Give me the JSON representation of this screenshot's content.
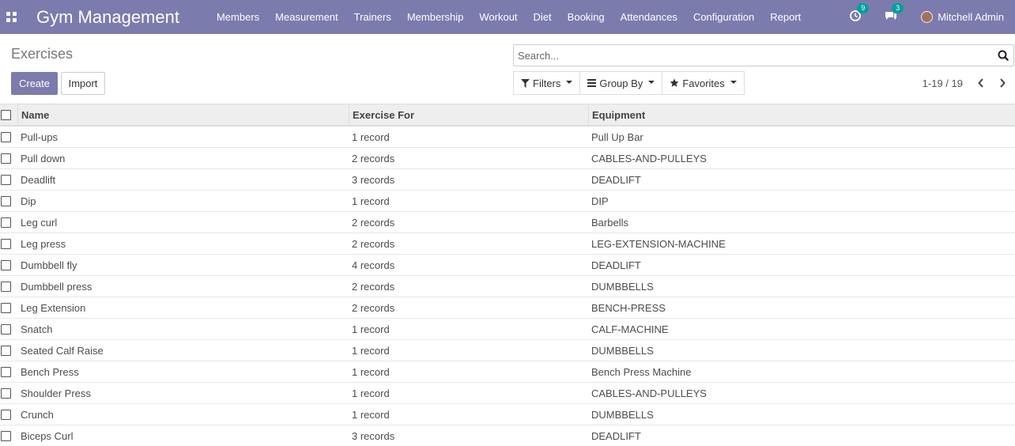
{
  "navbar": {
    "app_title": "Gym Management",
    "menu": [
      "Members",
      "Measurement",
      "Trainers",
      "Membership",
      "Workout",
      "Diet",
      "Booking",
      "Attendances",
      "Configuration",
      "Report"
    ],
    "activity_count": "9",
    "messages_count": "3",
    "user_name": "Mitchell Admin"
  },
  "control_panel": {
    "title": "Exercises",
    "create_label": "Create",
    "import_label": "Import",
    "search_placeholder": "Search...",
    "filters_label": "Filters",
    "group_by_label": "Group By",
    "favorites_label": "Favorites",
    "pager_value": "1-19 / 19"
  },
  "table": {
    "headers": {
      "name": "Name",
      "exercise_for": "Exercise For",
      "equipment": "Equipment"
    },
    "rows": [
      {
        "name": "Pull-ups",
        "exercise_for": "1 record",
        "equipment": "Pull Up Bar"
      },
      {
        "name": "Pull down",
        "exercise_for": "2 records",
        "equipment": "CABLES-AND-PULLEYS"
      },
      {
        "name": "Deadlift",
        "exercise_for": "3 records",
        "equipment": "DEADLIFT"
      },
      {
        "name": "Dip",
        "exercise_for": "1 record",
        "equipment": "DIP"
      },
      {
        "name": "Leg curl",
        "exercise_for": "2 records",
        "equipment": "Barbells"
      },
      {
        "name": "Leg press",
        "exercise_for": "2 records",
        "equipment": "LEG-EXTENSION-MACHINE"
      },
      {
        "name": "Dumbbell fly",
        "exercise_for": "4 records",
        "equipment": "DEADLIFT"
      },
      {
        "name": "Dumbbell press",
        "exercise_for": "2 records",
        "equipment": "DUMBBELLS"
      },
      {
        "name": "Leg Extension",
        "exercise_for": "2 records",
        "equipment": "BENCH-PRESS"
      },
      {
        "name": "Snatch",
        "exercise_for": "1 record",
        "equipment": "CALF-MACHINE"
      },
      {
        "name": "Seated Calf Raise",
        "exercise_for": "1 record",
        "equipment": "DUMBBELLS"
      },
      {
        "name": "Bench Press",
        "exercise_for": "1 record",
        "equipment": "Bench Press Machine"
      },
      {
        "name": "Shoulder Press",
        "exercise_for": "1 record",
        "equipment": "CABLES-AND-PULLEYS"
      },
      {
        "name": "Crunch",
        "exercise_for": "1 record",
        "equipment": "DUMBBELLS"
      },
      {
        "name": "Biceps Curl",
        "exercise_for": "3 records",
        "equipment": "DEADLIFT"
      }
    ]
  },
  "colors": {
    "brand": "#7c7bad",
    "badge": "#00a09d"
  }
}
